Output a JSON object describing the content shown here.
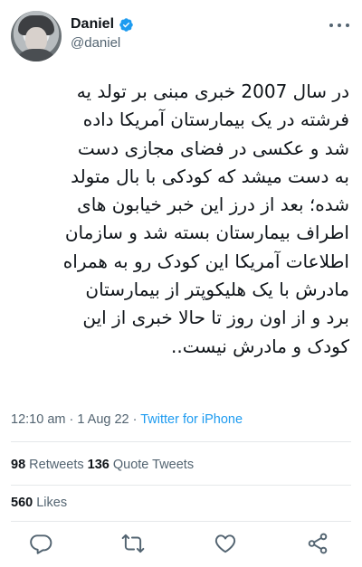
{
  "author": {
    "name": "Daniel",
    "handle": "@daniel",
    "verified": true
  },
  "tweet": {
    "lines": [
      "در سال 2007 خبری مبنی بر تولد یه",
      "فرشته در یک بیمارستان آمریکا داده",
      "شد و عکسی در فضای مجازی دست",
      "به دست میشد که کودکی با بال متولد",
      "شده؛ بعد از درز این خبر خیابون های",
      "اطراف بیمارستان بسته شد و سازمان",
      "اطلاعات آمریکا این کودک رو به همراه",
      "مادرش با یک هلیکوپتر  از بیمارستان",
      "برد و از اون روز تا حالا خبری از این",
      "کودک و مادرش نیست.."
    ]
  },
  "meta": {
    "time": "12:10 am",
    "separator": " · ",
    "date": "1 Aug 22",
    "source": "Twitter for iPhone"
  },
  "stats": {
    "retweets_count": "98",
    "retweets_label": " Retweets ",
    "quotes_count": "136",
    "quotes_label": " Quote Tweets",
    "likes_count": "560",
    "likes_label": " Likes"
  },
  "icons": {
    "verified": "verified-badge-icon",
    "more": "more-icon",
    "reply": "reply-icon",
    "retweet": "retweet-icon",
    "like": "like-icon",
    "share": "share-icon"
  },
  "colors": {
    "accent": "#1d9bf0",
    "secondary_text": "#536471",
    "primary_text": "#0f1419"
  }
}
